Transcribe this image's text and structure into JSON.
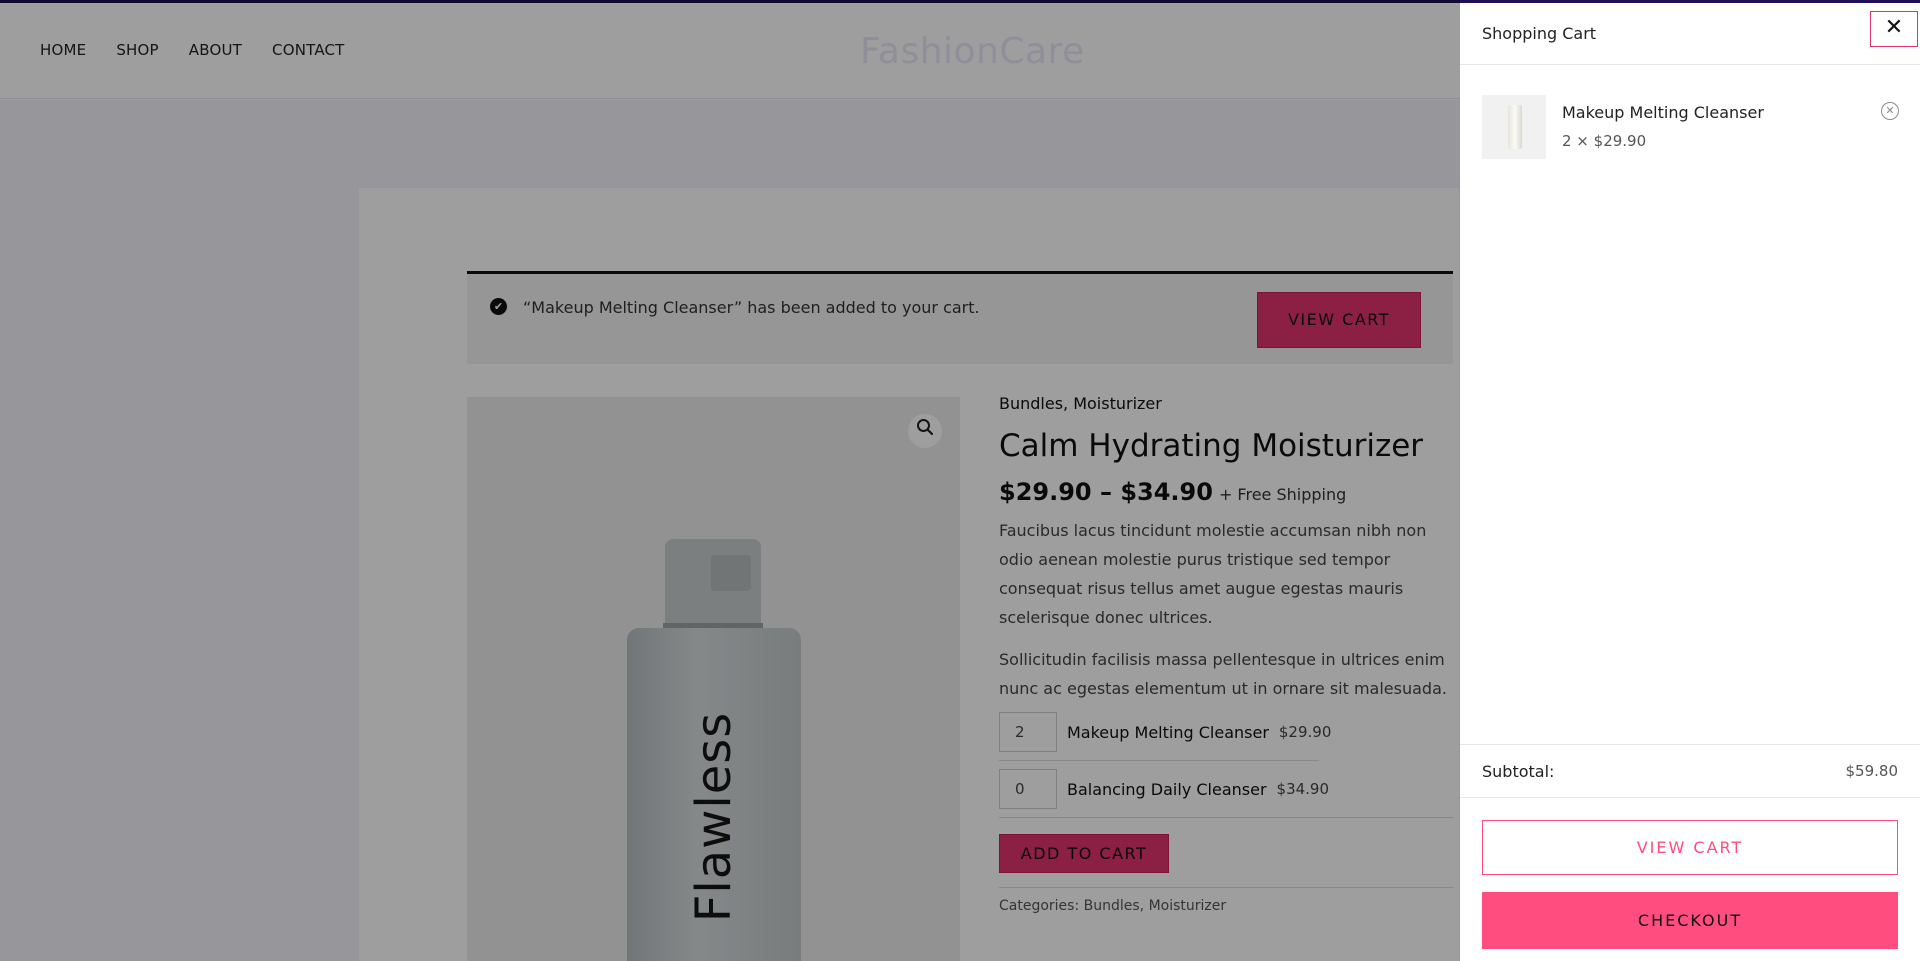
{
  "header": {
    "nav": [
      "HOME",
      "SHOP",
      "ABOUT",
      "CONTACT"
    ],
    "brand": "FashionCare"
  },
  "notice": {
    "message": "“Makeup Melting Cleanser” has been added to your cart.",
    "button": "VIEW CART"
  },
  "product": {
    "image_label": "Flawless",
    "categories_top": "Bundles, Moisturizer",
    "title": "Calm Hydrating Moisturizer",
    "price_range": "$29.90 – $34.90",
    "shipping": "+ Free Shipping",
    "desc1": "Faucibus lacus tincidunt molestie accumsan nibh non odio aenean molestie purus tristique sed tempor consequat risus tellus amet augue egestas mauris scelerisque donec ultrices.",
    "desc2": "Sollicitudin facilisis massa pellentesque in ultrices enim nunc ac egestas elementum ut in ornare sit malesuada.",
    "grouped": [
      {
        "qty": "2",
        "name": "Makeup Melting Cleanser",
        "price": "$29.90"
      },
      {
        "qty": "0",
        "name": "Balancing Daily Cleanser",
        "price": "$34.90"
      }
    ],
    "add_to_cart": "ADD TO CART",
    "categories_bottom": "Categories: Bundles, Moisturizer"
  },
  "cart": {
    "title": "Shopping Cart",
    "close": "✕",
    "items": [
      {
        "name": "Makeup Melting Cleanser",
        "meta": "2 × $29.90"
      }
    ],
    "subtotal_label": "Subtotal:",
    "subtotal_value": "$59.80",
    "view_cart": "VIEW CART",
    "checkout": "CHECKOUT"
  },
  "colors": {
    "accent": "#ff4d80",
    "accent_dark": "#e0326e",
    "top_line": "#1e0f56"
  },
  "icons": [
    "check-icon",
    "search-icon",
    "close-icon",
    "remove-icon"
  ]
}
